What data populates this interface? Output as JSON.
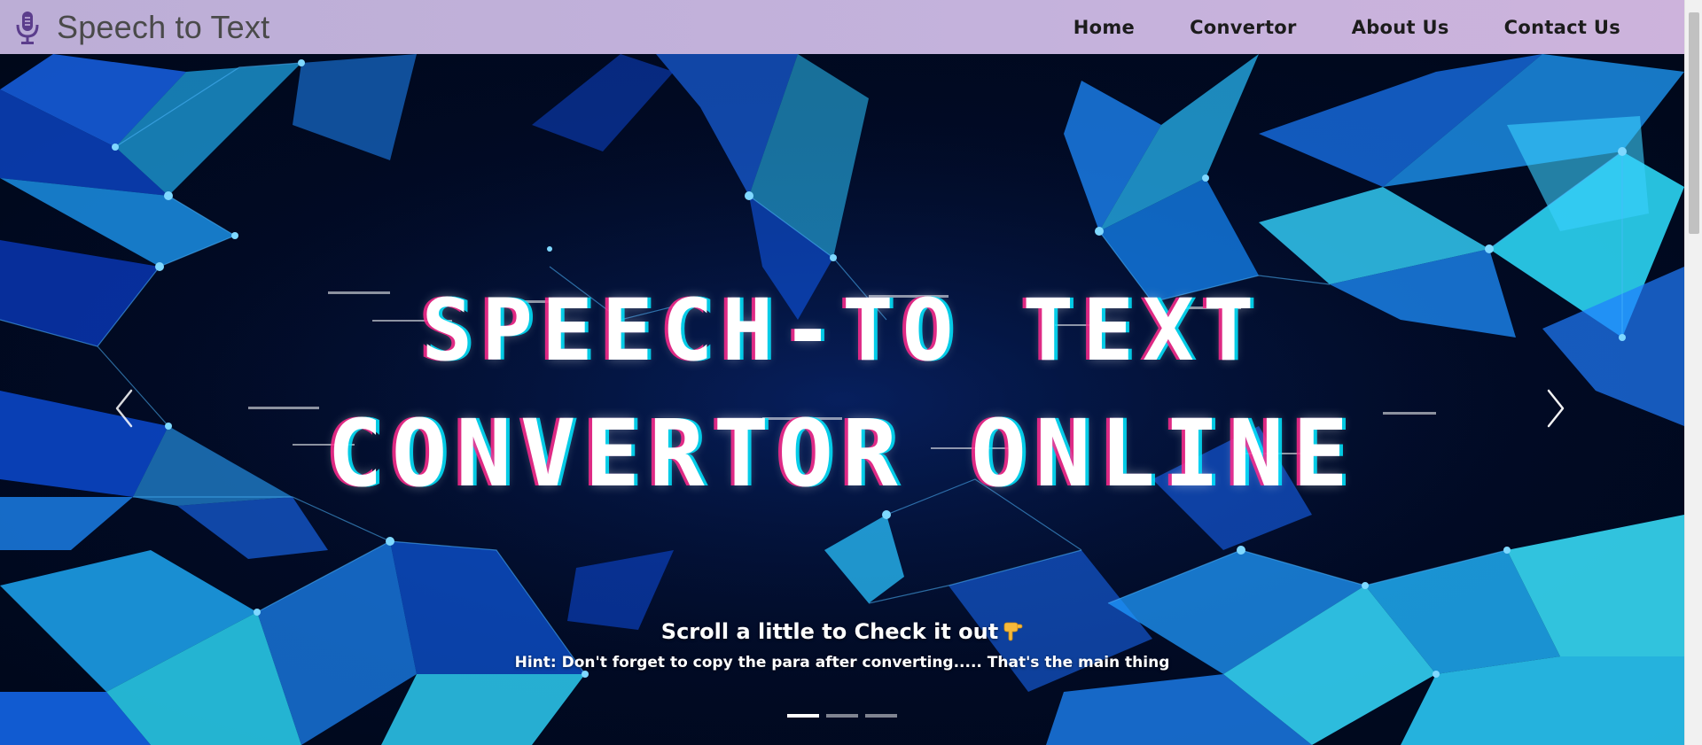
{
  "navbar": {
    "brand_icon": "microphone-icon",
    "brand_text": "Speech to Text",
    "links": [
      {
        "label": "Home"
      },
      {
        "label": "Convertor"
      },
      {
        "label": "About Us"
      },
      {
        "label": "Contact Us"
      }
    ]
  },
  "carousel": {
    "headline_line1": "SPEECH-TO TEXT",
    "headline_line2": "CONVERTOR ONLINE",
    "caption_title": "Scroll a little to Check it out",
    "caption_emoji": "pointing-down-hand-icon",
    "caption_hint": "Hint: Don't forget to copy the para after converting..... That's the main thing",
    "prev_icon": "chevron-left-icon",
    "next_icon": "chevron-right-icon",
    "slide_count": 3,
    "active_slide": 1
  },
  "colors": {
    "navbar_background": "#c4b2dc",
    "brand_icon": "#5b3d8c",
    "hero_background": "#010a24",
    "accent_cyan": "#00e5ff",
    "accent_blue": "#1f6bff"
  }
}
